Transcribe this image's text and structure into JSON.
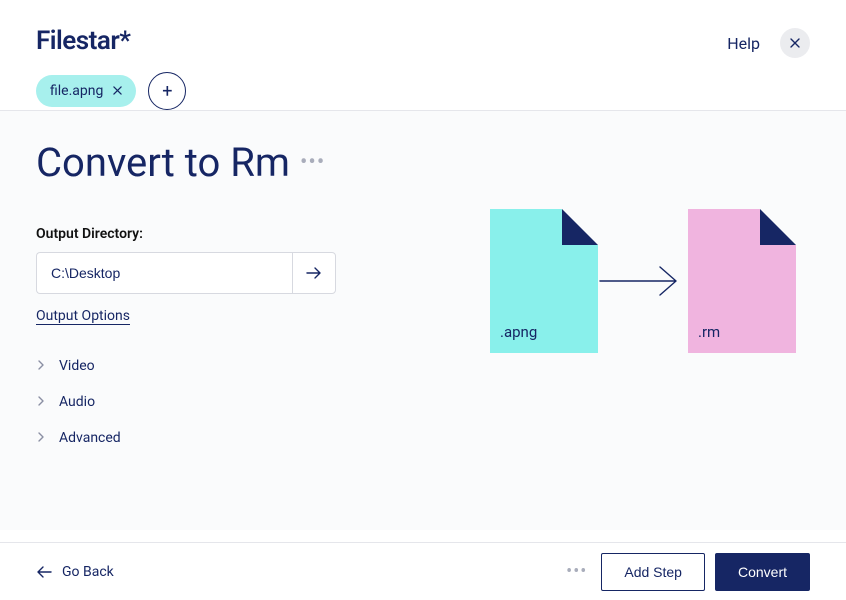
{
  "brand": "Filestar*",
  "header": {
    "help_label": "Help"
  },
  "chips": {
    "file_name": "file.apng"
  },
  "page": {
    "title": "Convert to Rm"
  },
  "output": {
    "label": "Output Directory:",
    "value": "C:\\Desktop",
    "options_link": "Output Options"
  },
  "accordion": {
    "items": [
      "Video",
      "Audio",
      "Advanced"
    ]
  },
  "illustration": {
    "from_ext": ".apng",
    "to_ext": ".rm"
  },
  "footer": {
    "go_back": "Go Back",
    "add_step": "Add Step",
    "convert": "Convert"
  }
}
